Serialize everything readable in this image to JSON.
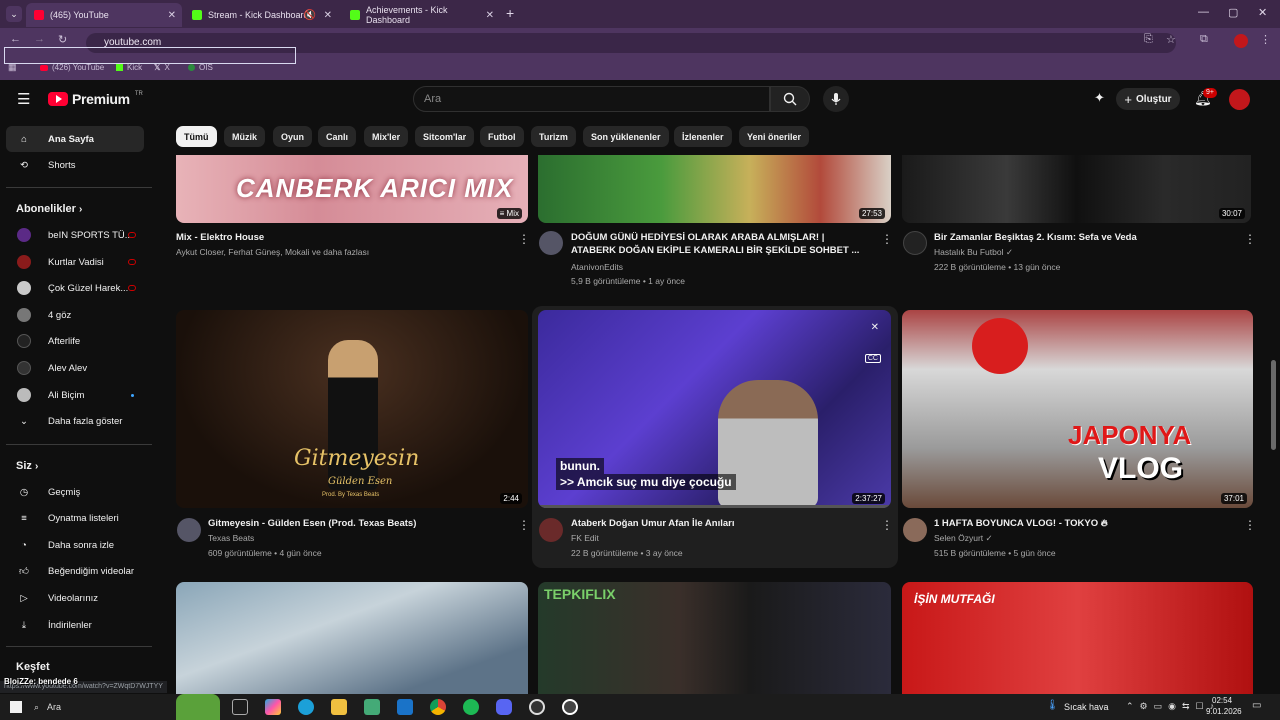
{
  "browser": {
    "tabs": [
      {
        "label": "(465) YouTube",
        "active": true
      },
      {
        "label": "Stream - Kick Dashboard",
        "active": false
      },
      {
        "label": "Achievements - Kick Dashboard",
        "active": false
      }
    ],
    "url": "youtube.com",
    "bookmarks": [
      "(426) YouTube",
      "Kick",
      "X",
      "OIS"
    ]
  },
  "header": {
    "logo_text": "Premium",
    "logo_sup": "TR",
    "search_placeholder": "Ara",
    "create_label": "Oluştur",
    "notif_badge": "9+"
  },
  "sidebar": {
    "main": [
      {
        "label": "Ana Sayfa",
        "icon": "home-icon"
      },
      {
        "label": "Shorts",
        "icon": "shorts-icon"
      }
    ],
    "subs_heading": "Abonelikler",
    "subs": [
      {
        "label": "beIN SPORTS TÜ...",
        "color": "#5b2a86",
        "live": true
      },
      {
        "label": "Kurtlar Vadisi",
        "color": "#8a1b1b",
        "live": true
      },
      {
        "label": "Çok Güzel Harek...",
        "color": "#c9c9c9",
        "live": true
      },
      {
        "label": "4 göz",
        "color": "#777777",
        "live": false
      },
      {
        "label": "Afterlife",
        "color": "#222222",
        "live": false
      },
      {
        "label": "Alev Alev",
        "color": "#333333",
        "live": false
      },
      {
        "label": "Ali Biçim",
        "color": "#bbbbbb",
        "live": false
      }
    ],
    "more_label": "Daha fazla göster",
    "you_heading": "Siz",
    "you": [
      {
        "label": "Geçmiş",
        "icon": "history-icon"
      },
      {
        "label": "Oynatma listeleri",
        "icon": "playlist-icon"
      },
      {
        "label": "Daha sonra izle",
        "icon": "watch-later-icon"
      },
      {
        "label": "Beğendiğim videolar",
        "icon": "like-icon"
      },
      {
        "label": "Videolarınız",
        "icon": "your-videos-icon"
      },
      {
        "label": "İndirilenler",
        "icon": "download-icon"
      }
    ],
    "explore_heading": "Keşfet"
  },
  "chips": [
    "Tümü",
    "Müzik",
    "Oyun",
    "Canlı",
    "Mix'ler",
    "Sitcom'lar",
    "Futbol",
    "Turizm",
    "Son yüklenenler",
    "İzlenenler",
    "Yeni öneriler"
  ],
  "videos_row1": [
    {
      "title": "Mix - Elektro House",
      "channel": "Aykut Closer, Ferhat Güneş, Mokali ve daha fazlası",
      "views": "",
      "duration": "Mix",
      "thumb_text": "CANBERK ARICI MIX"
    },
    {
      "title": "DOĞUM GÜNÜ HEDİYESİ OLARAK ARABA ALMIŞLAR! | ATABERK DOĞAN EKİPLE KAMERALI BİR ŞEKİLDE SOHBET ...",
      "channel": "AtanivonEdits",
      "views": "5,9 B görüntüleme • 1 ay önce",
      "duration": "27:53"
    },
    {
      "title": "Bir Zamanlar Beşiktaş 2. Kısım: Sefa ve Veda",
      "channel": "Hastalık Bu Futbol",
      "views": "222 B görüntüleme • 13 gün önce",
      "duration": "30:07"
    }
  ],
  "videos_row2": [
    {
      "title": "Gitmeyesin - Gülden Esen (Prod. Texas Beats)",
      "channel": "Texas Beats",
      "views": "609 görüntüleme • 4 gün önce",
      "duration": "2:44",
      "thumb_text": "Gitmeyesin",
      "thumb_sub": "Gülden Esen",
      "thumb_sub2": "Prod. By Texas Beats"
    },
    {
      "title": "Ataberk Doğan Umur Afan İle Anıları",
      "channel": "FK Edit",
      "views": "22 B görüntüleme • 3 ay önce",
      "duration": "2:37:27",
      "caption1": "bunun.",
      "caption2": ">> Amcık suç mu diye çocuğu"
    },
    {
      "title": "1 HAFTA BOYUNCA VLOG! - TOKYO",
      "channel": "Selen Özyurt",
      "views": "515 B görüntüleme • 5 gün önce",
      "duration": "37:01",
      "thumb_text": "JAPONYA",
      "thumb_text2": "VLOG"
    }
  ],
  "videos_row3": [
    {
      "thumb_text": ""
    },
    {
      "thumb_text": "TEPKIFLIX"
    },
    {
      "thumb_text": "İŞİN MUTFAĞI"
    }
  ],
  "status_url": "https://www.youtube.com/watch?v=ZWqtD7WJTYY",
  "overlay_text": "BloiZZe: bendede 6",
  "taskbar": {
    "search": "Ara",
    "weather": "Sıcak hava",
    "time": "02:54",
    "date": "9.01.2026"
  },
  "colors": {
    "accent_red": "#ff0033",
    "chrome": "#4e3560"
  }
}
